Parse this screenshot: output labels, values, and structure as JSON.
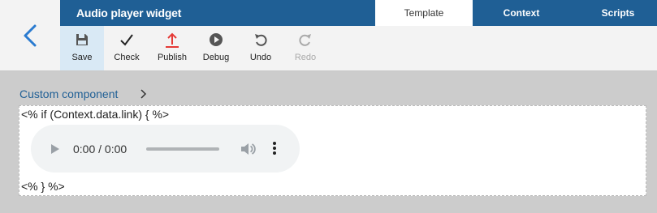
{
  "header": {
    "title": "Audio player widget",
    "tabs": [
      {
        "label": "Template",
        "active": true
      },
      {
        "label": "Context",
        "active": false
      },
      {
        "label": "Scripts",
        "active": false
      }
    ]
  },
  "toolbar": {
    "save_label": "Save",
    "check_label": "Check",
    "publish_label": "Publish",
    "debug_label": "Debug",
    "undo_label": "Undo",
    "redo_label": "Redo"
  },
  "breadcrumb": {
    "label": "Custom component"
  },
  "canvas": {
    "code_open": "<% if (Context.data.link) { %>",
    "code_close": "<% } %>",
    "player": {
      "time": "0:00 / 0:00",
      "progress": 0
    }
  },
  "colors": {
    "brand": "#1f5f95",
    "publish_accent": "#e53935",
    "active_tool_bg": "#d9e9f5"
  }
}
